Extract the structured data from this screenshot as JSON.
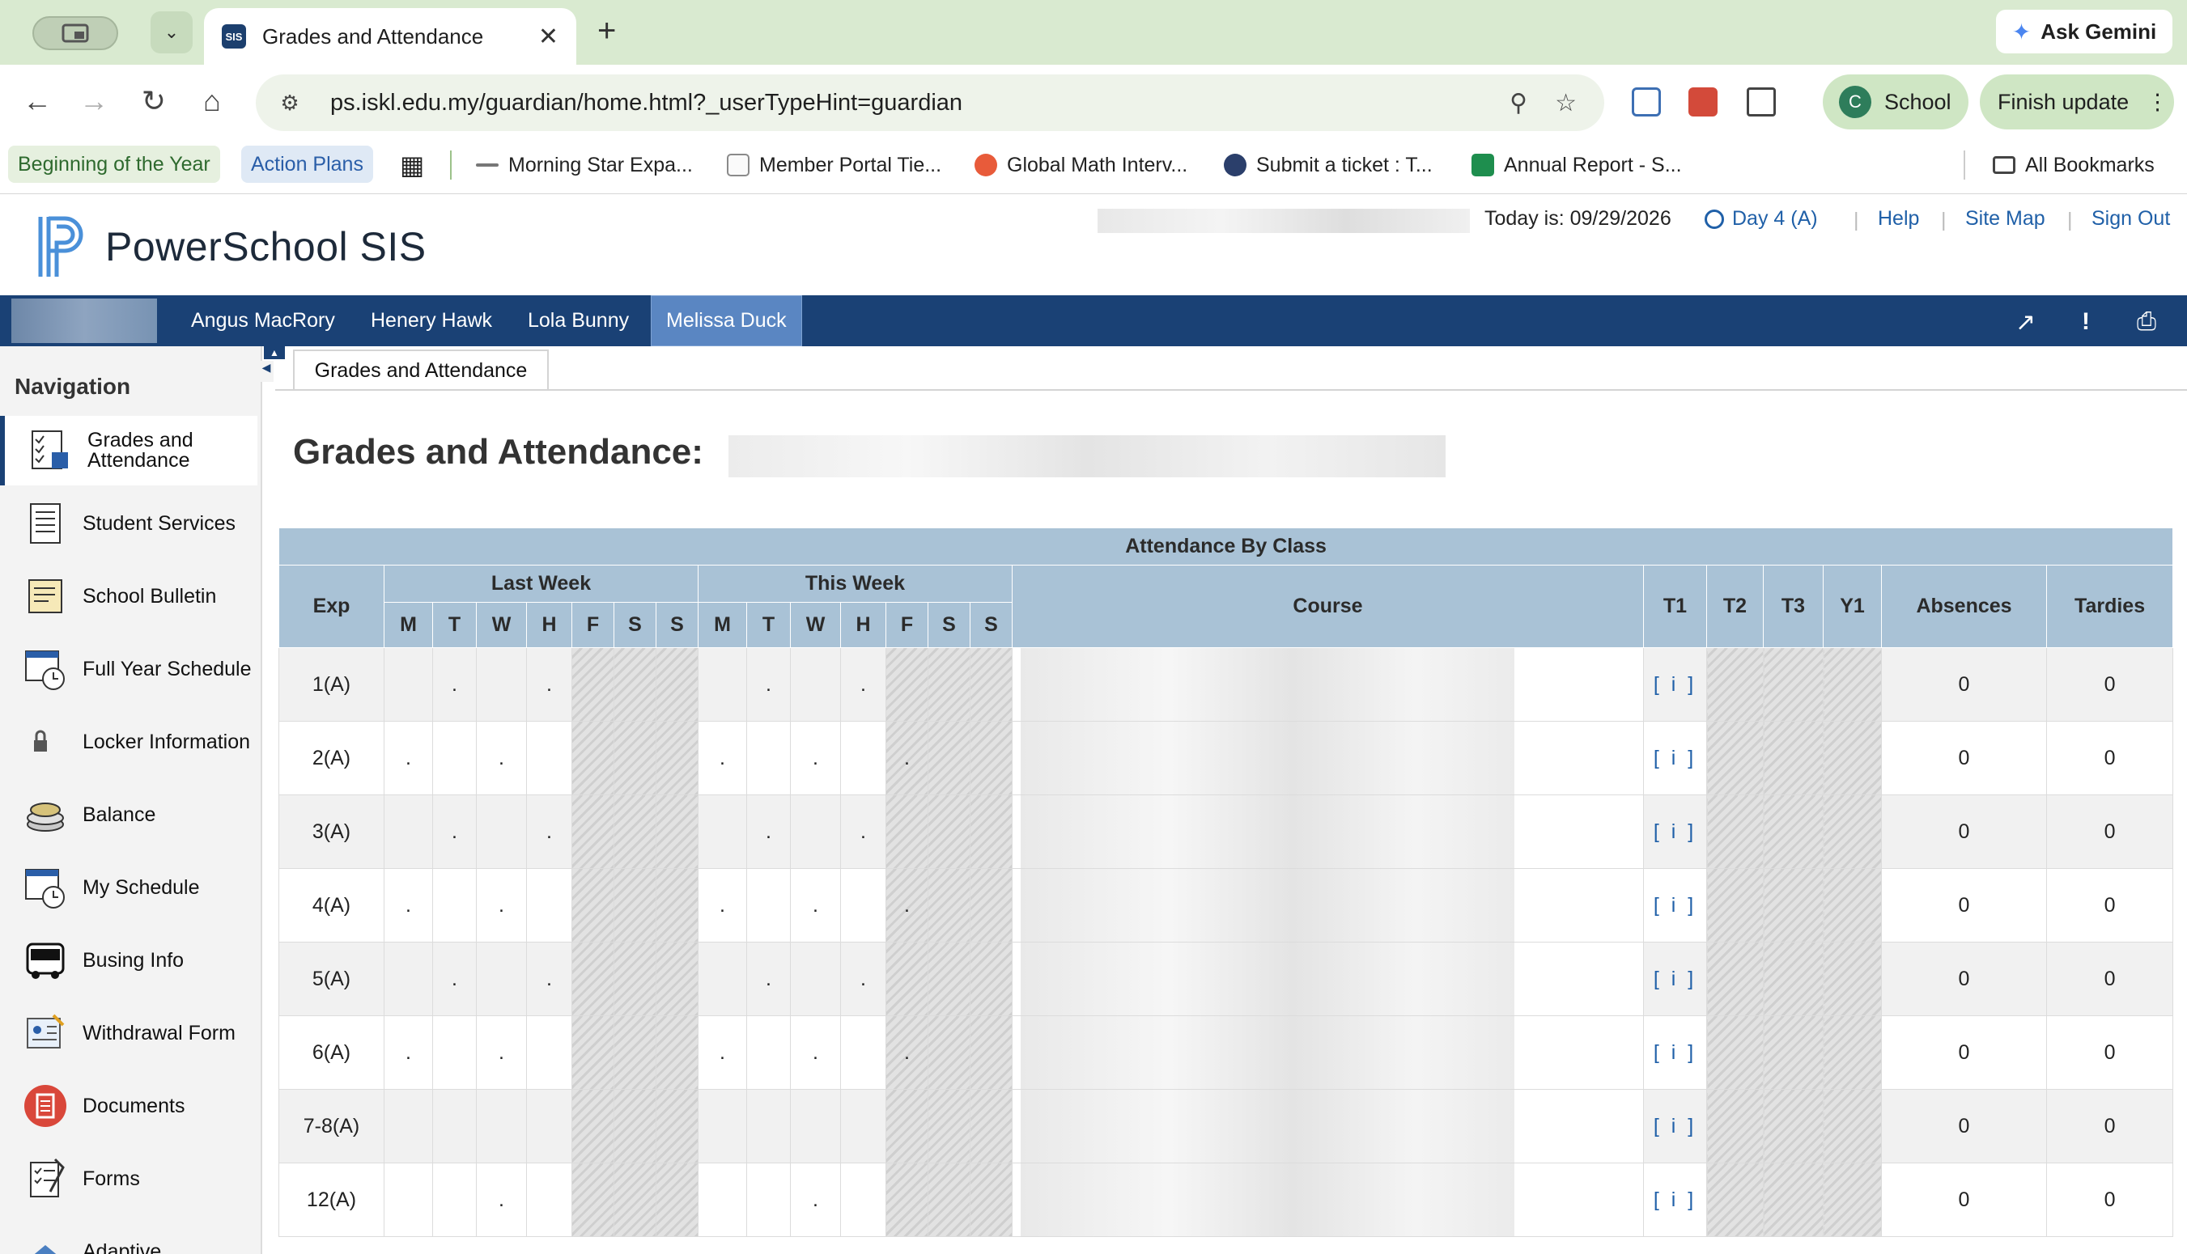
{
  "browser": {
    "tab_title": "Grades and Attendance",
    "tab_favicon": "SIS",
    "ask_gemini": "Ask Gemini",
    "url": "ps.iskl.edu.my/guardian/home.html?_userTypeHint=guardian",
    "profile_initial": "C",
    "profile_label": "School",
    "finish_update": "Finish update",
    "bookmarks": [
      "Beginning of the Year",
      "Action Plans",
      "Morning Star Expa...",
      "Member Portal Tie...",
      "Global Math Interv...",
      "Submit a ticket : T...",
      "Annual Report - S...",
      "All Bookmarks"
    ]
  },
  "header": {
    "brand": "PowerSchool SIS",
    "today": "Today is: 09/29/2026",
    "day": "Day 4 (A)",
    "links": {
      "help": "Help",
      "sitemap": "Site Map",
      "signout": "Sign Out"
    },
    "separator": "|"
  },
  "students": [
    "Angus MacRory",
    "Henery Hawk",
    "Lola Bunny",
    "Melissa Duck"
  ],
  "nav": {
    "title": "Navigation",
    "items": [
      {
        "label": "Grades and Attendance",
        "icon": "grades-icon"
      },
      {
        "label": "Student Services",
        "icon": "student-services-icon"
      },
      {
        "label": "School Bulletin",
        "icon": "bulletin-icon"
      },
      {
        "label": "Full Year Schedule",
        "icon": "calendar-clock-icon"
      },
      {
        "label": "Locker Information",
        "icon": "lock-icon"
      },
      {
        "label": "Balance",
        "icon": "coins-icon"
      },
      {
        "label": "My Schedule",
        "icon": "schedule-clock-icon"
      },
      {
        "label": "Busing Info",
        "icon": "bus-icon"
      },
      {
        "label": "Withdrawal Form",
        "icon": "withdrawal-form-icon"
      },
      {
        "label": "Documents",
        "icon": "documents-icon"
      },
      {
        "label": "Forms",
        "icon": "forms-icon"
      },
      {
        "label": "Adaptive",
        "icon": "adaptive-icon"
      }
    ]
  },
  "content": {
    "tab": "Grades and Attendance",
    "page_title": "Grades and Attendance:",
    "table": {
      "caption": "Attendance By Class",
      "headers": {
        "exp": "Exp",
        "last_week": "Last Week",
        "this_week": "This Week",
        "course": "Course",
        "t1": "T1",
        "t2": "T2",
        "t3": "T3",
        "y1": "Y1",
        "absences": "Absences",
        "tardies": "Tardies"
      },
      "days": [
        "M",
        "T",
        "W",
        "H",
        "F",
        "S",
        "S"
      ],
      "rows": [
        {
          "exp": "1(A)",
          "last": [
            "",
            ".",
            "",
            ".",
            "",
            "",
            ""
          ],
          "this": [
            "",
            ".",
            "",
            ".",
            "",
            "",
            ""
          ],
          "t1": "[ i ]",
          "absences": "0",
          "tardies": "0"
        },
        {
          "exp": "2(A)",
          "last": [
            ".",
            "",
            ".",
            "",
            "",
            "",
            ""
          ],
          "this": [
            ".",
            "",
            ".",
            "",
            ".",
            "",
            ""
          ],
          "t1": "[ i ]",
          "absences": "0",
          "tardies": "0"
        },
        {
          "exp": "3(A)",
          "last": [
            "",
            ".",
            "",
            ".",
            "",
            "",
            ""
          ],
          "this": [
            "",
            ".",
            "",
            ".",
            "",
            "",
            ""
          ],
          "t1": "[ i ]",
          "absences": "0",
          "tardies": "0"
        },
        {
          "exp": "4(A)",
          "last": [
            ".",
            "",
            ".",
            "",
            "",
            "",
            ""
          ],
          "this": [
            ".",
            "",
            ".",
            "",
            ".",
            "",
            ""
          ],
          "t1": "[ i ]",
          "absences": "0",
          "tardies": "0"
        },
        {
          "exp": "5(A)",
          "last": [
            "",
            ".",
            "",
            ".",
            "",
            "",
            ""
          ],
          "this": [
            "",
            ".",
            "",
            ".",
            "",
            "",
            ""
          ],
          "t1": "[ i ]",
          "absences": "0",
          "tardies": "0"
        },
        {
          "exp": "6(A)",
          "last": [
            ".",
            "",
            ".",
            "",
            "",
            "",
            ""
          ],
          "this": [
            ".",
            "",
            ".",
            "",
            ".",
            "",
            ""
          ],
          "t1": "[ i ]",
          "absences": "0",
          "tardies": "0"
        },
        {
          "exp": "7-8(A)",
          "last": [
            "",
            "",
            "",
            "",
            "",
            "",
            ""
          ],
          "this": [
            "",
            "",
            "",
            "",
            "",
            "",
            ""
          ],
          "t1": "[ i ]",
          "absences": "0",
          "tardies": "0"
        },
        {
          "exp": "12(A)",
          "last": [
            "",
            "",
            ".",
            "",
            "",
            "",
            ""
          ],
          "this": [
            "",
            "",
            ".",
            "",
            "",
            "",
            ""
          ],
          "t1": "[ i ]",
          "absences": "0",
          "tardies": "0"
        }
      ]
    }
  }
}
